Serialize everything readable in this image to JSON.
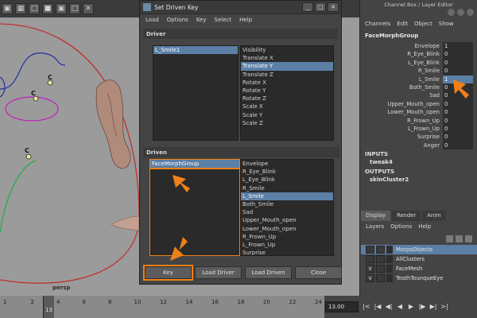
{
  "viewport": {
    "camera_label": "persp",
    "toolbar_icons": [
      "cube-icon",
      "grid-icon",
      "square-icon",
      "square-icon",
      "cube-icon",
      "square-icon",
      "close-icon"
    ]
  },
  "dialog": {
    "title": "Set Driven Key",
    "menu": [
      "Load",
      "Options",
      "Key",
      "Select",
      "Help"
    ],
    "driver_header": "Driver",
    "driver_objects": [
      "L_Smile1"
    ],
    "driver_attributes": [
      "Visibility",
      "Translate X",
      "Translate Y",
      "Translate Z",
      "Rotate X",
      "Rotate Y",
      "Rotate Z",
      "Scale X",
      "Scale Y",
      "Scale Z"
    ],
    "driver_selected_attribute": "Translate Y",
    "driven_header": "Driven",
    "driven_objects": [
      "FaceMorphGroup"
    ],
    "driven_attributes": [
      "Envelope",
      "R_Eye_Blink",
      "L_Eye_Blink",
      "R_Smile",
      "L_Smile",
      "Both_Smile",
      "Sad",
      "Upper_Mouth_open",
      "Lower_Mouth_open",
      "R_Frown_Up",
      "L_Frown_Up",
      "Surprise",
      "Anger"
    ],
    "driven_selected_attribute": "L_Smile",
    "buttons": {
      "key": "Key",
      "load_driver": "Load Driver",
      "load_driven": "Load Driven",
      "close": "Close"
    }
  },
  "channel_box": {
    "title": "Channel Box / Layer Editor",
    "menu": [
      "Channels",
      "Edit",
      "Object",
      "Show"
    ],
    "object_name": "FaceMorphGroup",
    "attributes": [
      {
        "name": "Envelope",
        "value": "1"
      },
      {
        "name": "R_Eye_Blink",
        "value": "0"
      },
      {
        "name": "L_Eye_Blink",
        "value": "0"
      },
      {
        "name": "R_Smile",
        "value": "0"
      },
      {
        "name": "L_Smile",
        "value": "1"
      },
      {
        "name": "Both_Smile",
        "value": "0"
      },
      {
        "name": "Sad",
        "value": "0"
      },
      {
        "name": "Upper_Mouth_open",
        "value": "0"
      },
      {
        "name": "Lower_Mouth_open",
        "value": "0"
      },
      {
        "name": "R_Frown_Up",
        "value": "0"
      },
      {
        "name": "L_Frown_Up",
        "value": "0"
      },
      {
        "name": "Surprise",
        "value": "0"
      },
      {
        "name": "Anger",
        "value": "0"
      }
    ],
    "inputs_label": "INPUTS",
    "inputs": [
      "tweak4"
    ],
    "outputs_label": "OUTPUTS",
    "outputs": [
      "skinCluster2"
    ]
  },
  "layer_editor": {
    "tabs": [
      "Display",
      "Render",
      "Anim"
    ],
    "menu": [
      "Layers",
      "Options",
      "Help"
    ],
    "layers": [
      {
        "name": "MorpsObjects",
        "visible": ""
      },
      {
        "name": "AllClusters",
        "visible": ""
      },
      {
        "name": "FaceMesh",
        "visible": "V"
      },
      {
        "name": "TeathTounqueEye",
        "visible": "V"
      }
    ]
  },
  "timeline": {
    "ticks": [
      "1",
      "2",
      "4",
      "6",
      "8",
      "10",
      "12",
      "14",
      "16",
      "18",
      "20",
      "22",
      "24"
    ],
    "current_frame": "13",
    "frame_field": "13.00",
    "transport": [
      "|<",
      "|◀",
      "◀|",
      "◀",
      "▶",
      "|▶",
      "▶|",
      ">|"
    ]
  },
  "colors": {
    "selection": "#5c7fa6",
    "highlight_outline": "#f08018",
    "viewport_bg": "#9b9b9b",
    "panel_bg": "#444444"
  }
}
